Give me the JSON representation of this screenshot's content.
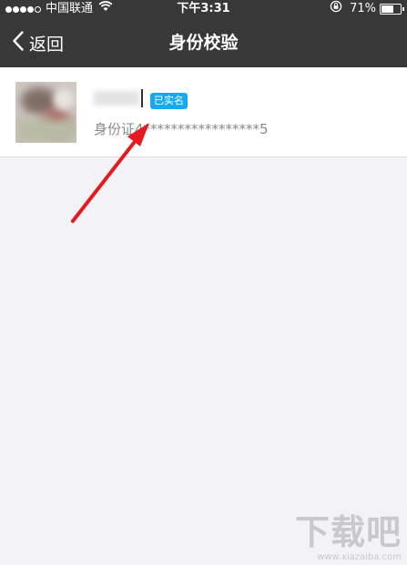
{
  "status_bar": {
    "carrier": "中国联通",
    "time": "下午3:31",
    "battery_percent": "71%",
    "battery_level": 0.71,
    "icons": [
      "signal-dots-icon",
      "wifi-icon",
      "orientation-lock-icon",
      "battery-icon"
    ]
  },
  "nav": {
    "back_label": "返回",
    "title": "身份校验",
    "icons": [
      "chevron-left-icon"
    ]
  },
  "card": {
    "badge": "已实名",
    "id_label": "身份证",
    "id_value": "4*****************5",
    "name_redacted": true,
    "avatar_redacted": true
  },
  "annotation": {
    "type": "red-arrow",
    "color": "#e8191e"
  },
  "watermark": {
    "logo_text": "下载吧",
    "url": "www.xiazaiba.com"
  },
  "colors": {
    "bar_background": "#383838",
    "badge_background": "#19a9f0",
    "page_background": "#f3f2f7"
  }
}
